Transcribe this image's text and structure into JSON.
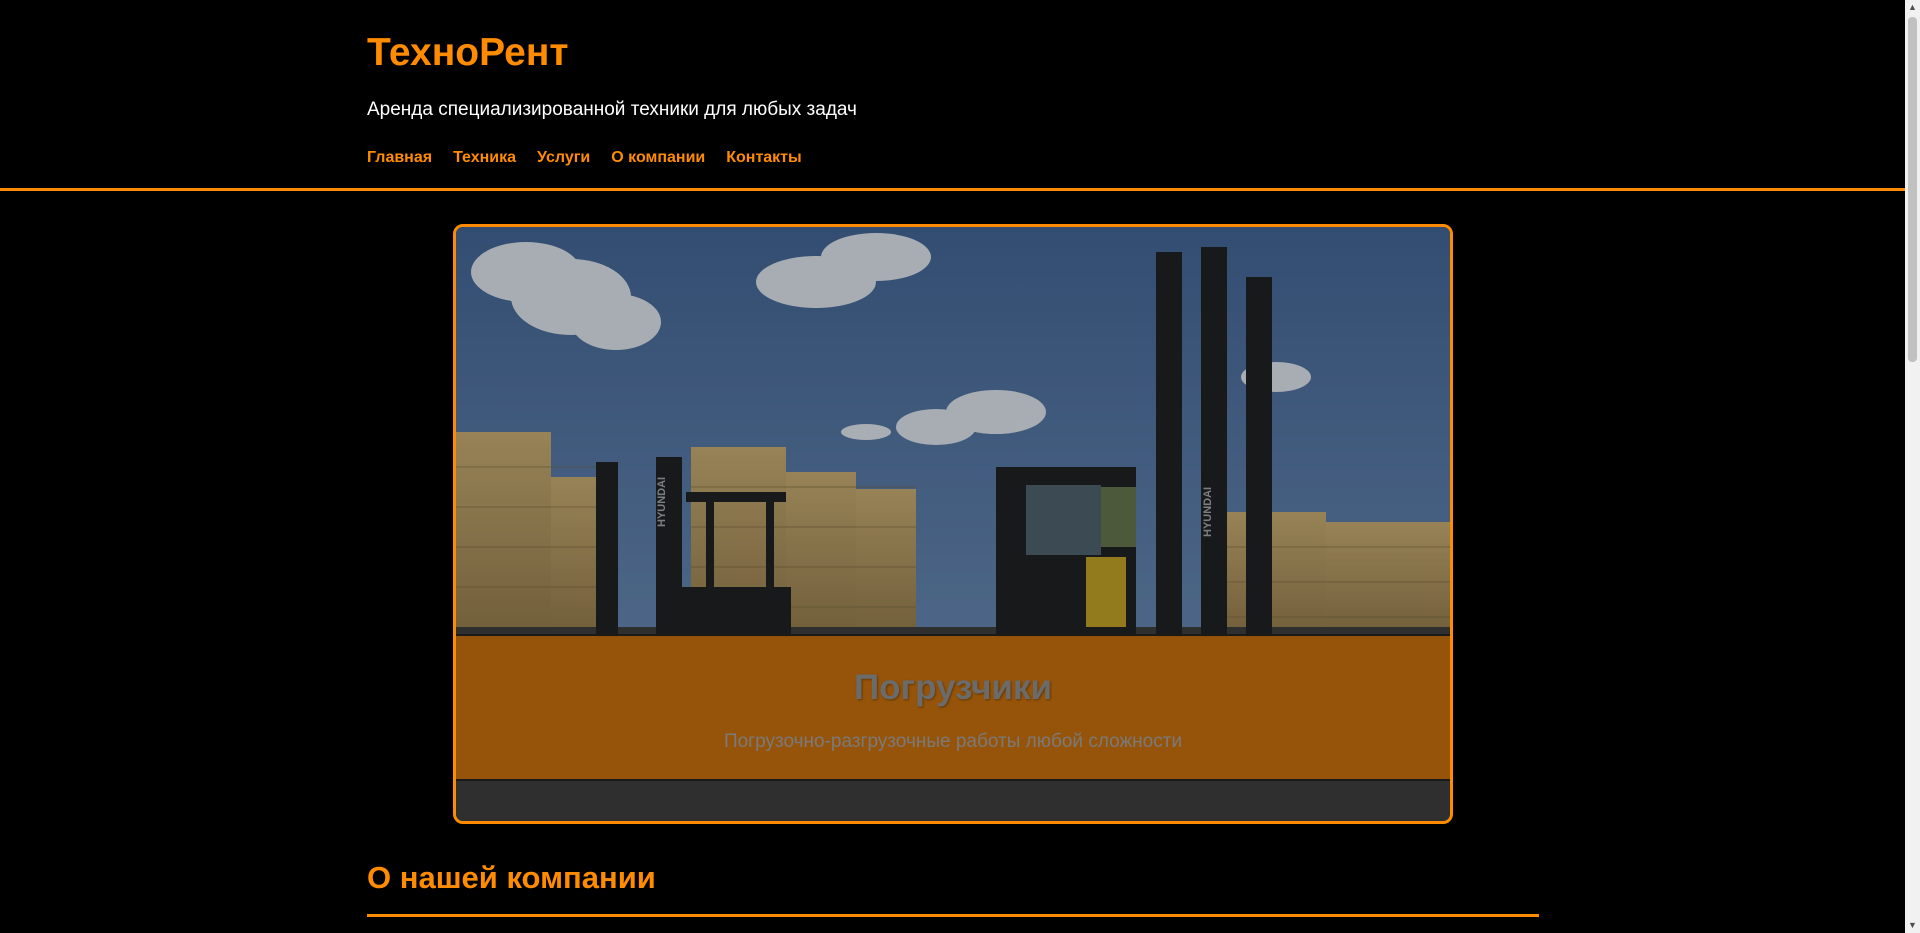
{
  "header": {
    "title": "ТехноРент",
    "tagline": "Аренда специализированной техники для любых задач",
    "nav": [
      "Главная",
      "Техника",
      "Услуги",
      "О компании",
      "Контакты"
    ]
  },
  "hero": {
    "title": "Погрузчики",
    "subtitle": "Погрузочно-разгрузочные работы любой сложности",
    "image_text": "HYUNDAI"
  },
  "section": {
    "title": "О нашей компании"
  },
  "colors": {
    "accent": "#ff8c00",
    "background": "#000000",
    "text": "#ffffff"
  },
  "icons": {
    "scroll_up": "scroll-up-arrow-icon",
    "scroll_down": "scroll-down-arrow-icon"
  }
}
